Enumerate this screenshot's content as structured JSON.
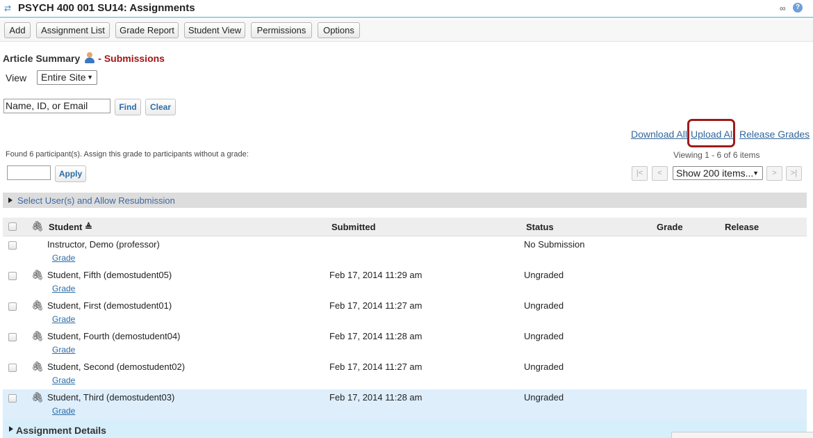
{
  "title": "PSYCH 400 001 SU14: Assignments",
  "toolbar": [
    "Add",
    "Assignment List",
    "Grade Report",
    "Student View",
    "Permissions",
    "Options"
  ],
  "breadcrumb": {
    "assignment": "Article Summary",
    "section": "- Submissions"
  },
  "view": {
    "label": "View",
    "selected": "Entire Site"
  },
  "search": {
    "value": "Name, ID, or Email",
    "find": "Find",
    "clear": "Clear"
  },
  "links": {
    "download_all": "Download All",
    "upload_all": "Upload All",
    "release_grades": "Release Grades"
  },
  "found_text": "Found 6 participant(s). Assign this grade to participants without a grade:",
  "apply": "Apply",
  "viewing": "Viewing 1 - 6 of 6 items",
  "pager": {
    "first": "|<",
    "prev": "<",
    "page_size": "Show 200 items...",
    "next": ">",
    "last": ">|"
  },
  "resubmission": "Select User(s) and Allow Resubmission",
  "columns": {
    "student": "Student",
    "sort_indicator": "≜",
    "submitted": "Submitted",
    "status": "Status",
    "grade": "Grade",
    "release": "Release"
  },
  "rows": [
    {
      "student": "Instructor, Demo (professor)",
      "submitted": "",
      "status": "No Submission",
      "grade_link": "Grade",
      "attachment": false
    },
    {
      "student": "Student, Fifth (demostudent05)",
      "submitted": "Feb 17, 2014 11:29 am",
      "status": "Ungraded",
      "grade_link": "Grade",
      "attachment": true
    },
    {
      "student": "Student, First (demostudent01)",
      "submitted": "Feb 17, 2014 11:27 am",
      "status": "Ungraded",
      "grade_link": "Grade",
      "attachment": true
    },
    {
      "student": "Student, Fourth (demostudent04)",
      "submitted": "Feb 17, 2014 11:28 am",
      "status": "Ungraded",
      "grade_link": "Grade",
      "attachment": true
    },
    {
      "student": "Student, Second (demostudent02)",
      "submitted": "Feb 17, 2014 11:27 am",
      "status": "Ungraded",
      "grade_link": "Grade",
      "attachment": true
    },
    {
      "student": "Student, Third (demostudent03)",
      "submitted": "Feb 17, 2014 11:28 am",
      "status": "Ungraded",
      "grade_link": "Grade",
      "attachment": true
    }
  ],
  "details": "Assignment Details",
  "colors": {
    "accent_link": "#33669a",
    "highlight_box": "#9c1c1c",
    "selected_row": "#deeefb",
    "title_rule": "#9ccfe0"
  },
  "icons": [
    "reset-icon",
    "link-icon",
    "help-icon",
    "user-icon",
    "paperclip-icon",
    "sort-asc-icon",
    "expand-triangle-icon"
  ]
}
